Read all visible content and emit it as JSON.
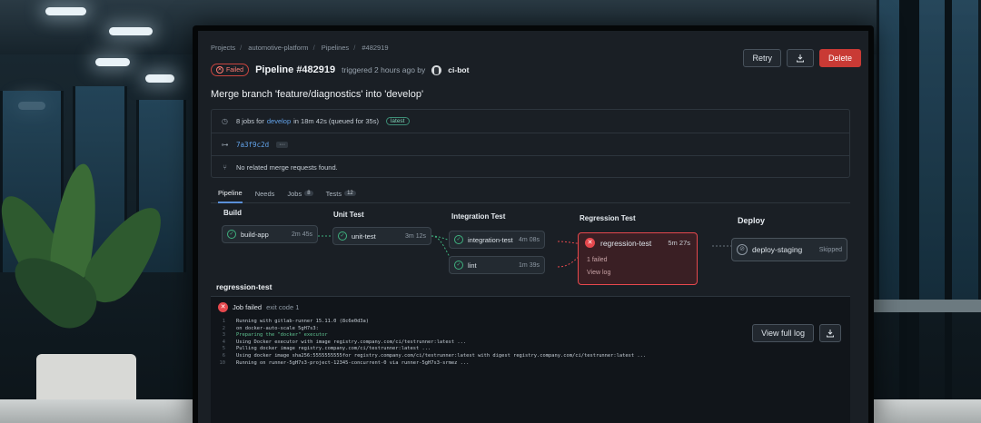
{
  "breadcrumbs": [
    "Projects",
    "automotive-platform",
    "Pipelines",
    "#482919"
  ],
  "header": {
    "status": "Failed",
    "pipeline_title": "Pipeline #482919",
    "triggered": "triggered 2 hours ago by",
    "user": "ci-bot",
    "merge_title": "Merge branch 'feature/diagnostics' into 'develop'"
  },
  "toolbar": {
    "retry_label": "Retry",
    "delete_label": "Delete"
  },
  "info": {
    "jobs_prefix": "8 jobs for",
    "branch": "develop",
    "jobs_suffix": "in 18m 42s (queued for 35s)",
    "tag": "latest",
    "commit": "7a3f9c2d",
    "more": "···",
    "mr": "No related merge requests found."
  },
  "tabs": [
    {
      "label": "Pipeline"
    },
    {
      "label": "Needs"
    },
    {
      "label": "Jobs",
      "count": "8"
    },
    {
      "label": "Tests",
      "count": "12"
    }
  ],
  "stages": {
    "build": {
      "name": "Build",
      "jobs": [
        {
          "name": "build-app",
          "duration": "2m 45s"
        }
      ]
    },
    "unit": {
      "name": "Unit Test",
      "jobs": [
        {
          "name": "unit-test",
          "duration": "3m 12s"
        }
      ]
    },
    "integration": {
      "name": "Integration Test",
      "jobs": [
        {
          "name": "integration-test",
          "duration": "4m 08s"
        },
        {
          "name": "lint",
          "duration": "1m 39s"
        }
      ]
    },
    "regression": {
      "name": "Regression Test",
      "jobs": [
        {
          "name": "regression-test",
          "duration": "5m 27s",
          "failed": "1 failed",
          "view": "View log"
        }
      ]
    },
    "deploy": {
      "name": "Deploy",
      "jobs": [
        {
          "name": "deploy-staging",
          "status": "Skipped"
        }
      ]
    }
  },
  "log": {
    "title": "regression-test",
    "failed_label": "Job failed",
    "exit_code": "exit code 1",
    "view_full_log": "View full log",
    "lines": [
      {
        "n": "1",
        "text": "Running with gitlab-runner 15.11.0 (8c6e0d3a)"
      },
      {
        "n": "2",
        "text": "  on docker-auto-scale 5gH7s3:"
      },
      {
        "n": "3",
        "text": "Preparing the \"docker\" executor",
        "green": true
      },
      {
        "n": "4",
        "text": "Using Docker executor with image registry.company.com/ci/testrunner:latest ..."
      },
      {
        "n": "5",
        "text": "Pulling docker image registry.company.com/ci/testrunner:latest ..."
      },
      {
        "n": "6",
        "text": "Using docker image sha256:5555555555for registry.company.com/ci/testrunner:latest with digest registry.company.com/ci/testrunner:latest ..."
      },
      {
        "n": "10",
        "text": "Running on runner-5gH7s3-project-12345-concurrent-0 via runner-5gH7s3-srmez ..."
      }
    ]
  },
  "colors": {
    "accent": "#5a8fd8",
    "danger": "#c93a35",
    "success": "#3fb27f",
    "failed": "#e5484d"
  }
}
